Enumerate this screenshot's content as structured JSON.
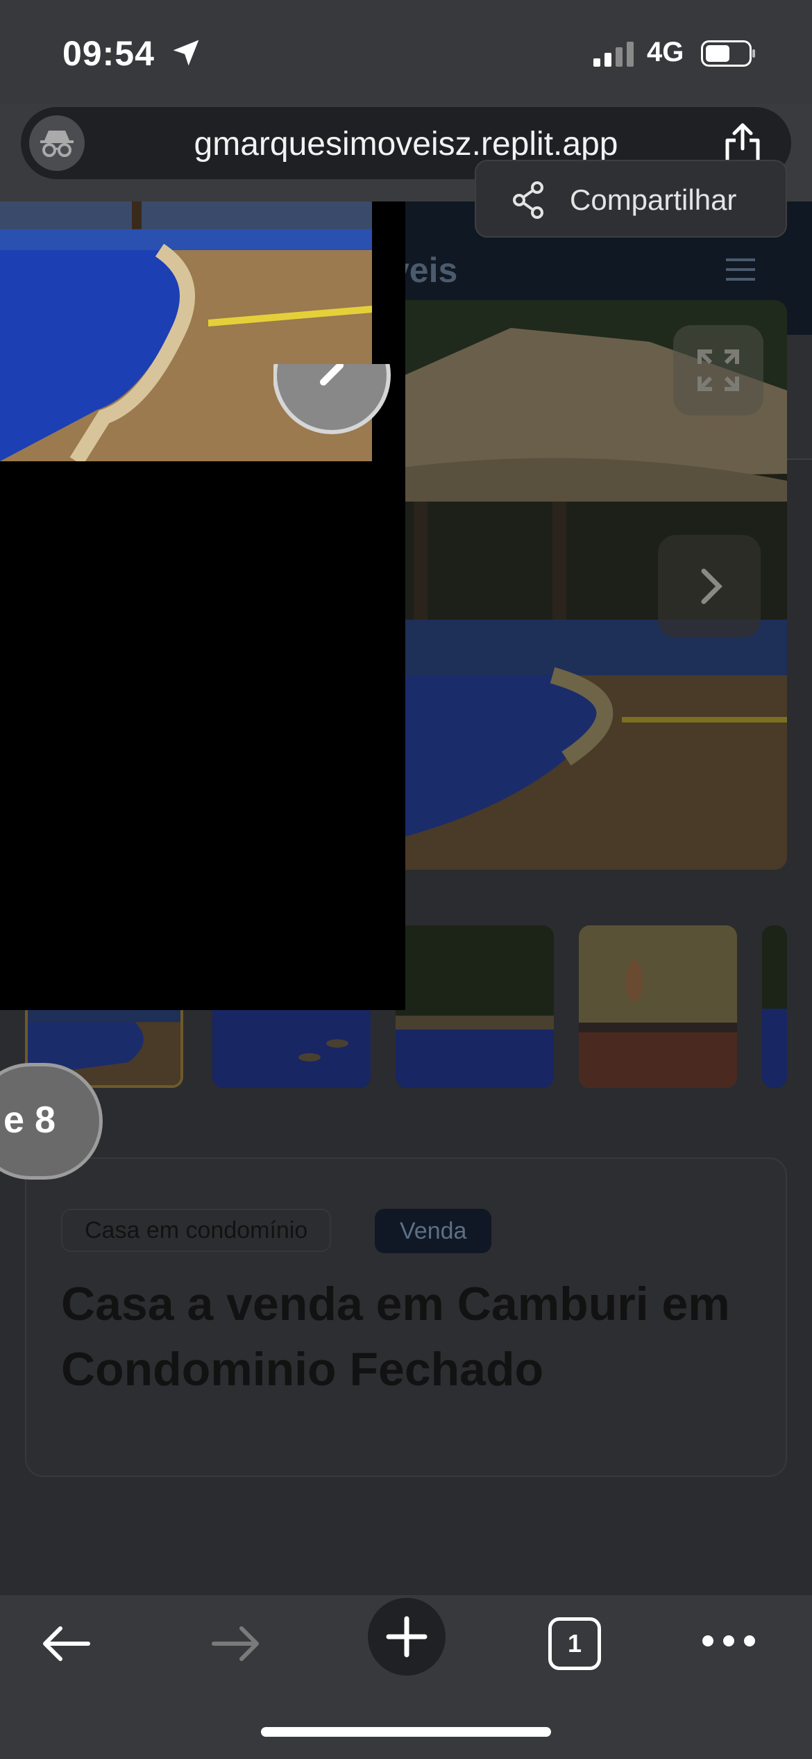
{
  "status_bar": {
    "time": "09:54",
    "network": "4G",
    "icons": [
      "location-arrow-icon",
      "signal-icon",
      "battery-icon"
    ]
  },
  "browser": {
    "url": "gmarquesimoveisz.replit.app",
    "icons": [
      "incognito-icon",
      "share-icon"
    ],
    "tab_count": "1"
  },
  "site": {
    "brand_partial": "veis",
    "share_label": "Compartilhar"
  },
  "gallery": {
    "counter_partial": "e 8",
    "thumbnails": [
      "thumb-pool-kiosk",
      "thumb-pool-seats",
      "thumb-pool-garden",
      "thumb-kitchen",
      "thumb-pool-partial"
    ]
  },
  "listing": {
    "type_badge": "Casa em condomínio",
    "status_badge": "Venda",
    "title": "Casa a venda em Camburi em Condominio Fechado"
  },
  "colors": {
    "header_bg": "#101823",
    "page_bg": "#2b2c2f",
    "sale_badge_bg": "#0f1824"
  }
}
